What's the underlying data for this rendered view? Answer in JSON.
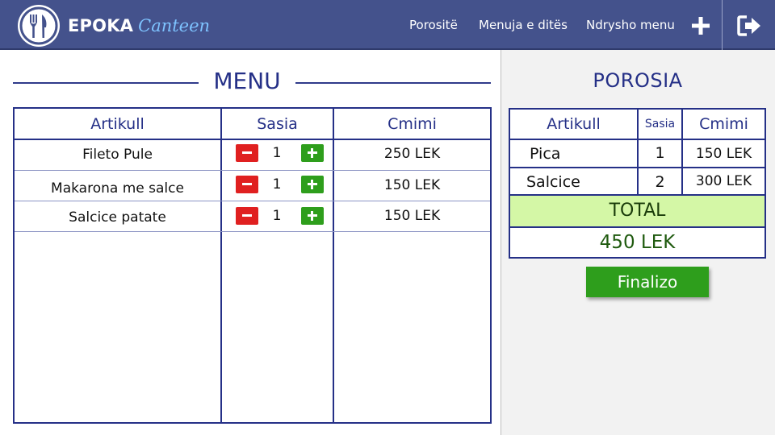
{
  "header": {
    "brand_main": "EPOKA",
    "brand_sub": "Canteen",
    "nav": [
      "Porositë",
      "Menuja e ditës",
      "Ndrysho menu"
    ],
    "add_icon": "plus-icon",
    "logout_icon": "logout-icon",
    "logo_icon": "fork-knife-icon",
    "colors": {
      "bar": "#44528c",
      "brand_sub": "#7ec3ff"
    }
  },
  "menu": {
    "title": "MENU",
    "columns": [
      "Artikull",
      "Sasia",
      "Cmimi"
    ],
    "items": [
      {
        "name": "Fileto Pule",
        "qty": "1",
        "price": "250 LEK"
      },
      {
        "name": "Makarona me salce",
        "qty": "1",
        "price": "150 LEK"
      },
      {
        "name": "Salcice patate",
        "qty": "1",
        "price": "150 LEK"
      }
    ],
    "colors": {
      "border": "#253087",
      "minus": "#e02020",
      "plus": "#2e9e1c"
    }
  },
  "order": {
    "title": "POROSIA",
    "columns": [
      "Artikull",
      "Sasia",
      "Cmimi"
    ],
    "items": [
      {
        "name": "Pica",
        "qty": "1",
        "price": "150 LEK"
      },
      {
        "name": "Salcice",
        "qty": "2",
        "price": "300 LEK"
      }
    ],
    "total_label": "TOTAL",
    "total_value": "450 LEK",
    "finalize_label": "Finalizo",
    "colors": {
      "total_bg": "#d4f7a6",
      "finalize": "#2e9e1c"
    }
  }
}
